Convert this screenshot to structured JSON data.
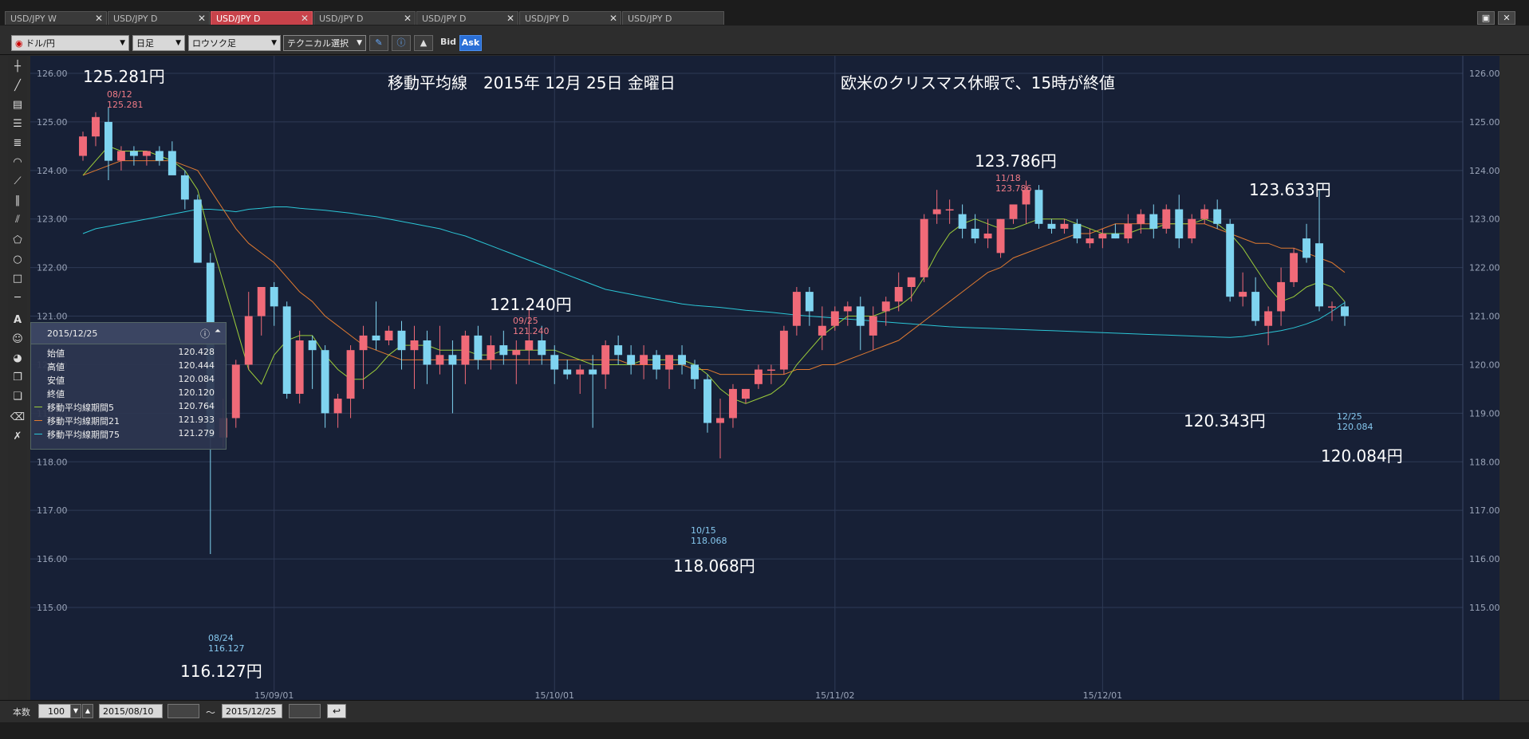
{
  "tabs": [
    {
      "label": "USD/JPY W",
      "active": false
    },
    {
      "label": "USD/JPY D",
      "active": false
    },
    {
      "label": "USD/JPY D",
      "active": true
    },
    {
      "label": "USD/JPY D",
      "active": false
    },
    {
      "label": "USD/JPY D",
      "active": false
    },
    {
      "label": "USD/JPY D",
      "active": false
    },
    {
      "label": "USD/JPY D",
      "active": false
    }
  ],
  "toolbar": {
    "pair": "ドル/円",
    "period": "日足",
    "chart_style": "ロウソク足",
    "technical": "テクニカル選択",
    "bid": "Bid",
    "ask": "Ask"
  },
  "annotations": {
    "title": "移動平均線　2015年 12月 25日 金曜日",
    "note": "欧米のクリスマス休暇で、15時が終値",
    "high_1": "125.281円",
    "low_1": "116.127円",
    "high_2": "121.240円",
    "low_2": "118.068円",
    "high_3": "123.786円",
    "high_4": "123.633円",
    "low_4": "120.343円",
    "last": "120.084円"
  },
  "highlights": {
    "h1_date": "08/12",
    "h1_val": "125.281",
    "l1_date": "08/24",
    "l1_val": "116.127",
    "h2_date": "09/25",
    "h2_val": "121.240",
    "l2_date": "10/15",
    "l2_val": "118.068",
    "h3_date": "11/18",
    "h3_val": "123.786",
    "last_date": "12/25",
    "last_val": "120.084"
  },
  "info_panel": {
    "date": "2015/12/25",
    "rows": [
      {
        "label": "始値",
        "value": "120.428",
        "color": ""
      },
      {
        "label": "高値",
        "value": "120.444",
        "color": ""
      },
      {
        "label": "安値",
        "value": "120.084",
        "color": ""
      },
      {
        "label": "終値",
        "value": "120.120",
        "color": ""
      },
      {
        "label": "移動平均線期間5",
        "value": "120.764",
        "color": "#9ccc3a"
      },
      {
        "label": "移動平均線期間21",
        "value": "121.933",
        "color": "#e07a30"
      },
      {
        "label": "移動平均線期間75",
        "value": "121.279",
        "color": "#2bc6d6"
      }
    ]
  },
  "bottom": {
    "count_label": "本数",
    "count": "100",
    "from": "2015/08/10",
    "tilde": "～",
    "to": "2015/12/25"
  },
  "colors": {
    "up": "#f06a78",
    "down": "#7fd4f0",
    "ma5": "#9ccc3a",
    "ma21": "#e07a30",
    "ma75": "#2bc6d6",
    "bg": "#172036"
  },
  "chart_data": {
    "type": "candlestick",
    "ylim": [
      115,
      126.5
    ],
    "y_ticks": [
      "126.00",
      "125.00",
      "124.00",
      "123.00",
      "122.00",
      "121.00",
      "120.00",
      "119.00",
      "118.00",
      "117.00",
      "116.00",
      "115.00"
    ],
    "x_ticks": [
      {
        "label": "15/09/01",
        "index": 15
      },
      {
        "label": "15/10/01",
        "index": 37
      },
      {
        "label": "15/11/02",
        "index": 59
      },
      {
        "label": "15/12/01",
        "index": 80
      }
    ],
    "candles": [
      [
        124.3,
        124.8,
        124.2,
        124.7
      ],
      [
        124.7,
        125.2,
        124.5,
        125.1
      ],
      [
        125.0,
        125.3,
        123.8,
        124.2
      ],
      [
        124.2,
        124.5,
        124.0,
        124.4
      ],
      [
        124.4,
        124.5,
        124.1,
        124.3
      ],
      [
        124.3,
        124.4,
        124.1,
        124.4
      ],
      [
        124.4,
        124.5,
        124.1,
        124.2
      ],
      [
        124.4,
        124.6,
        124.2,
        123.9
      ],
      [
        123.9,
        124.0,
        123.2,
        123.4
      ],
      [
        123.4,
        123.5,
        122.3,
        122.1
      ],
      [
        122.1,
        122.3,
        116.1,
        118.5
      ],
      [
        118.5,
        119.3,
        118.3,
        118.9
      ],
      [
        118.9,
        120.1,
        118.7,
        120.0
      ],
      [
        120.0,
        121.5,
        119.9,
        121.0
      ],
      [
        121.0,
        121.6,
        120.6,
        121.6
      ],
      [
        121.6,
        121.7,
        120.8,
        121.2
      ],
      [
        121.2,
        121.3,
        119.3,
        119.4
      ],
      [
        119.4,
        120.7,
        119.2,
        120.5
      ],
      [
        120.5,
        120.6,
        119.5,
        120.3
      ],
      [
        120.3,
        120.4,
        118.7,
        119.0
      ],
      [
        119.0,
        119.4,
        118.7,
        119.3
      ],
      [
        119.3,
        120.4,
        118.9,
        120.3
      ],
      [
        120.3,
        120.8,
        119.5,
        120.6
      ],
      [
        120.6,
        121.3,
        120.3,
        120.5
      ],
      [
        120.5,
        120.8,
        120.4,
        120.7
      ],
      [
        120.7,
        120.9,
        119.9,
        120.3
      ],
      [
        120.3,
        120.8,
        119.5,
        120.5
      ],
      [
        120.5,
        120.7,
        119.6,
        120.0
      ],
      [
        120.0,
        120.8,
        119.8,
        120.2
      ],
      [
        120.2,
        120.5,
        119.0,
        120.0
      ],
      [
        120.0,
        120.7,
        119.6,
        120.6
      ],
      [
        120.6,
        120.8,
        119.9,
        120.1
      ],
      [
        120.1,
        120.6,
        119.9,
        120.4
      ],
      [
        120.4,
        120.7,
        120.0,
        120.2
      ],
      [
        120.2,
        120.5,
        119.6,
        120.3
      ],
      [
        120.3,
        121.2,
        120.0,
        120.5
      ],
      [
        120.5,
        120.8,
        120.0,
        120.2
      ],
      [
        120.2,
        120.4,
        119.6,
        119.9
      ],
      [
        119.9,
        120.1,
        119.7,
        119.8
      ],
      [
        119.8,
        120.0,
        119.4,
        119.9
      ],
      [
        119.9,
        120.2,
        118.7,
        119.8
      ],
      [
        119.8,
        120.5,
        119.5,
        120.4
      ],
      [
        120.4,
        120.6,
        120.0,
        120.2
      ],
      [
        120.2,
        120.4,
        119.8,
        120.0
      ],
      [
        120.0,
        120.4,
        119.7,
        120.2
      ],
      [
        120.2,
        120.3,
        119.7,
        119.9
      ],
      [
        119.9,
        120.2,
        119.5,
        120.2
      ],
      [
        120.2,
        120.4,
        119.8,
        120.0
      ],
      [
        120.0,
        120.1,
        119.5,
        119.7
      ],
      [
        119.7,
        119.8,
        118.6,
        118.8
      ],
      [
        118.8,
        119.3,
        118.07,
        118.9
      ],
      [
        118.9,
        119.6,
        118.7,
        119.5
      ],
      [
        119.3,
        119.5,
        119.2,
        119.5
      ],
      [
        119.6,
        120.0,
        119.5,
        119.9
      ],
      [
        119.9,
        120.0,
        119.6,
        119.9
      ],
      [
        119.9,
        120.8,
        119.8,
        120.7
      ],
      [
        120.8,
        121.6,
        120.6,
        121.5
      ],
      [
        121.5,
        121.6,
        120.8,
        121.1
      ],
      [
        120.6,
        121.2,
        120.3,
        120.8
      ],
      [
        120.8,
        121.2,
        120.7,
        121.1
      ],
      [
        121.1,
        121.3,
        120.8,
        121.2
      ],
      [
        121.2,
        121.4,
        120.3,
        120.8
      ],
      [
        120.6,
        121.2,
        120.3,
        121.0
      ],
      [
        121.1,
        121.4,
        120.8,
        121.3
      ],
      [
        121.3,
        121.9,
        121.1,
        121.6
      ],
      [
        121.6,
        121.8,
        121.3,
        121.8
      ],
      [
        121.8,
        123.1,
        121.7,
        123.0
      ],
      [
        123.1,
        123.6,
        122.9,
        123.2
      ],
      [
        123.2,
        123.4,
        122.9,
        123.2
      ],
      [
        123.1,
        123.3,
        122.6,
        122.8
      ],
      [
        122.8,
        123.1,
        122.5,
        122.6
      ],
      [
        122.6,
        123.0,
        122.4,
        122.7
      ],
      [
        122.3,
        123.0,
        122.2,
        123.0
      ],
      [
        123.0,
        123.3,
        122.9,
        123.3
      ],
      [
        123.3,
        123.79,
        122.9,
        123.6
      ],
      [
        123.6,
        123.7,
        122.8,
        122.9
      ],
      [
        122.9,
        123.0,
        122.7,
        122.8
      ],
      [
        122.8,
        123.0,
        122.7,
        122.9
      ],
      [
        122.9,
        123.0,
        122.5,
        122.6
      ],
      [
        122.5,
        122.8,
        122.4,
        122.6
      ],
      [
        122.6,
        122.8,
        122.4,
        122.7
      ],
      [
        122.7,
        122.9,
        122.6,
        122.6
      ],
      [
        122.6,
        123.1,
        122.5,
        122.9
      ],
      [
        122.9,
        123.2,
        122.7,
        123.1
      ],
      [
        123.1,
        123.3,
        122.6,
        122.8
      ],
      [
        122.8,
        123.3,
        122.7,
        123.2
      ],
      [
        123.2,
        123.5,
        122.4,
        122.6
      ],
      [
        122.6,
        123.1,
        122.5,
        123.0
      ],
      [
        123.0,
        123.3,
        122.9,
        123.2
      ],
      [
        123.2,
        123.4,
        122.8,
        122.9
      ],
      [
        122.9,
        123.0,
        121.3,
        121.4
      ],
      [
        121.4,
        121.9,
        121.2,
        121.5
      ],
      [
        121.5,
        121.8,
        120.8,
        120.9
      ],
      [
        120.8,
        121.2,
        120.4,
        121.1
      ],
      [
        121.1,
        122.0,
        120.8,
        121.7
      ],
      [
        121.7,
        122.4,
        121.6,
        122.3
      ],
      [
        122.6,
        122.9,
        122.1,
        122.2
      ],
      [
        122.5,
        123.6,
        121.1,
        121.2
      ],
      [
        121.2,
        121.3,
        120.9,
        121.2
      ],
      [
        121.2,
        121.3,
        120.8,
        121.0
      ]
    ],
    "ma5": [
      123.9,
      124.2,
      124.5,
      124.4,
      124.4,
      124.4,
      124.3,
      124.2,
      124.0,
      123.6,
      122.6,
      121.7,
      120.8,
      119.9,
      119.6,
      120.2,
      120.5,
      120.6,
      120.6,
      120.2,
      119.9,
      119.7,
      119.7,
      119.9,
      120.2,
      120.4,
      120.4,
      120.4,
      120.3,
      120.3,
      120.3,
      120.2,
      120.2,
      120.3,
      120.3,
      120.3,
      120.3,
      120.3,
      120.2,
      120.1,
      120.0,
      120.0,
      120.0,
      120.0,
      120.1,
      120.1,
      120.1,
      120.1,
      120.0,
      119.8,
      119.5,
      119.3,
      119.2,
      119.3,
      119.4,
      119.6,
      120.0,
      120.3,
      120.6,
      120.8,
      121.0,
      121.0,
      121.0,
      121.1,
      121.2,
      121.4,
      121.8,
      122.3,
      122.7,
      122.9,
      123.0,
      122.9,
      122.8,
      122.8,
      122.9,
      123.0,
      123.0,
      123.0,
      122.9,
      122.8,
      122.7,
      122.7,
      122.7,
      122.8,
      122.8,
      122.9,
      122.9,
      122.9,
      123.0,
      122.9,
      122.7,
      122.4,
      122.0,
      121.6,
      121.3,
      121.4,
      121.6,
      121.7,
      121.6,
      121.3
    ],
    "ma21": [
      123.9,
      124.0,
      124.1,
      124.2,
      124.2,
      124.2,
      124.2,
      124.2,
      124.1,
      124.0,
      123.6,
      123.2,
      122.8,
      122.5,
      122.3,
      122.1,
      121.8,
      121.5,
      121.3,
      121.0,
      120.8,
      120.6,
      120.4,
      120.3,
      120.2,
      120.1,
      120.1,
      120.1,
      120.1,
      120.1,
      120.1,
      120.1,
      120.1,
      120.1,
      120.1,
      120.1,
      120.1,
      120.1,
      120.1,
      120.1,
      120.1,
      120.1,
      120.1,
      120.0,
      120.0,
      120.0,
      120.0,
      120.0,
      119.9,
      119.9,
      119.8,
      119.8,
      119.8,
      119.8,
      119.8,
      119.8,
      119.9,
      119.9,
      120.0,
      120.0,
      120.1,
      120.2,
      120.3,
      120.4,
      120.5,
      120.7,
      120.9,
      121.1,
      121.3,
      121.5,
      121.7,
      121.9,
      122.0,
      122.2,
      122.3,
      122.4,
      122.5,
      122.6,
      122.7,
      122.7,
      122.8,
      122.9,
      122.9,
      122.9,
      122.9,
      122.9,
      122.9,
      122.9,
      122.9,
      122.8,
      122.7,
      122.6,
      122.5,
      122.5,
      122.4,
      122.4,
      122.3,
      122.2,
      122.1,
      121.9
    ],
    "ma75": [
      122.7,
      122.8,
      122.85,
      122.9,
      122.95,
      123.0,
      123.05,
      123.1,
      123.15,
      123.2,
      123.2,
      123.18,
      123.15,
      123.2,
      123.22,
      123.25,
      123.25,
      123.22,
      123.2,
      123.18,
      123.15,
      123.12,
      123.08,
      123.05,
      123.0,
      122.95,
      122.9,
      122.85,
      122.8,
      122.72,
      122.65,
      122.55,
      122.45,
      122.35,
      122.25,
      122.15,
      122.05,
      121.95,
      121.85,
      121.75,
      121.65,
      121.55,
      121.5,
      121.45,
      121.4,
      121.35,
      121.3,
      121.25,
      121.22,
      121.2,
      121.18,
      121.15,
      121.12,
      121.1,
      121.08,
      121.05,
      121.02,
      121.0,
      120.98,
      120.96,
      120.94,
      120.92,
      120.9,
      120.88,
      120.86,
      120.84,
      120.82,
      120.8,
      120.78,
      120.77,
      120.76,
      120.75,
      120.74,
      120.73,
      120.72,
      120.71,
      120.7,
      120.69,
      120.68,
      120.67,
      120.66,
      120.65,
      120.64,
      120.63,
      120.62,
      120.61,
      120.6,
      120.59,
      120.58,
      120.57,
      120.56,
      120.58,
      120.62,
      120.66,
      120.7,
      120.76,
      120.84,
      120.94,
      121.1,
      121.28
    ]
  }
}
